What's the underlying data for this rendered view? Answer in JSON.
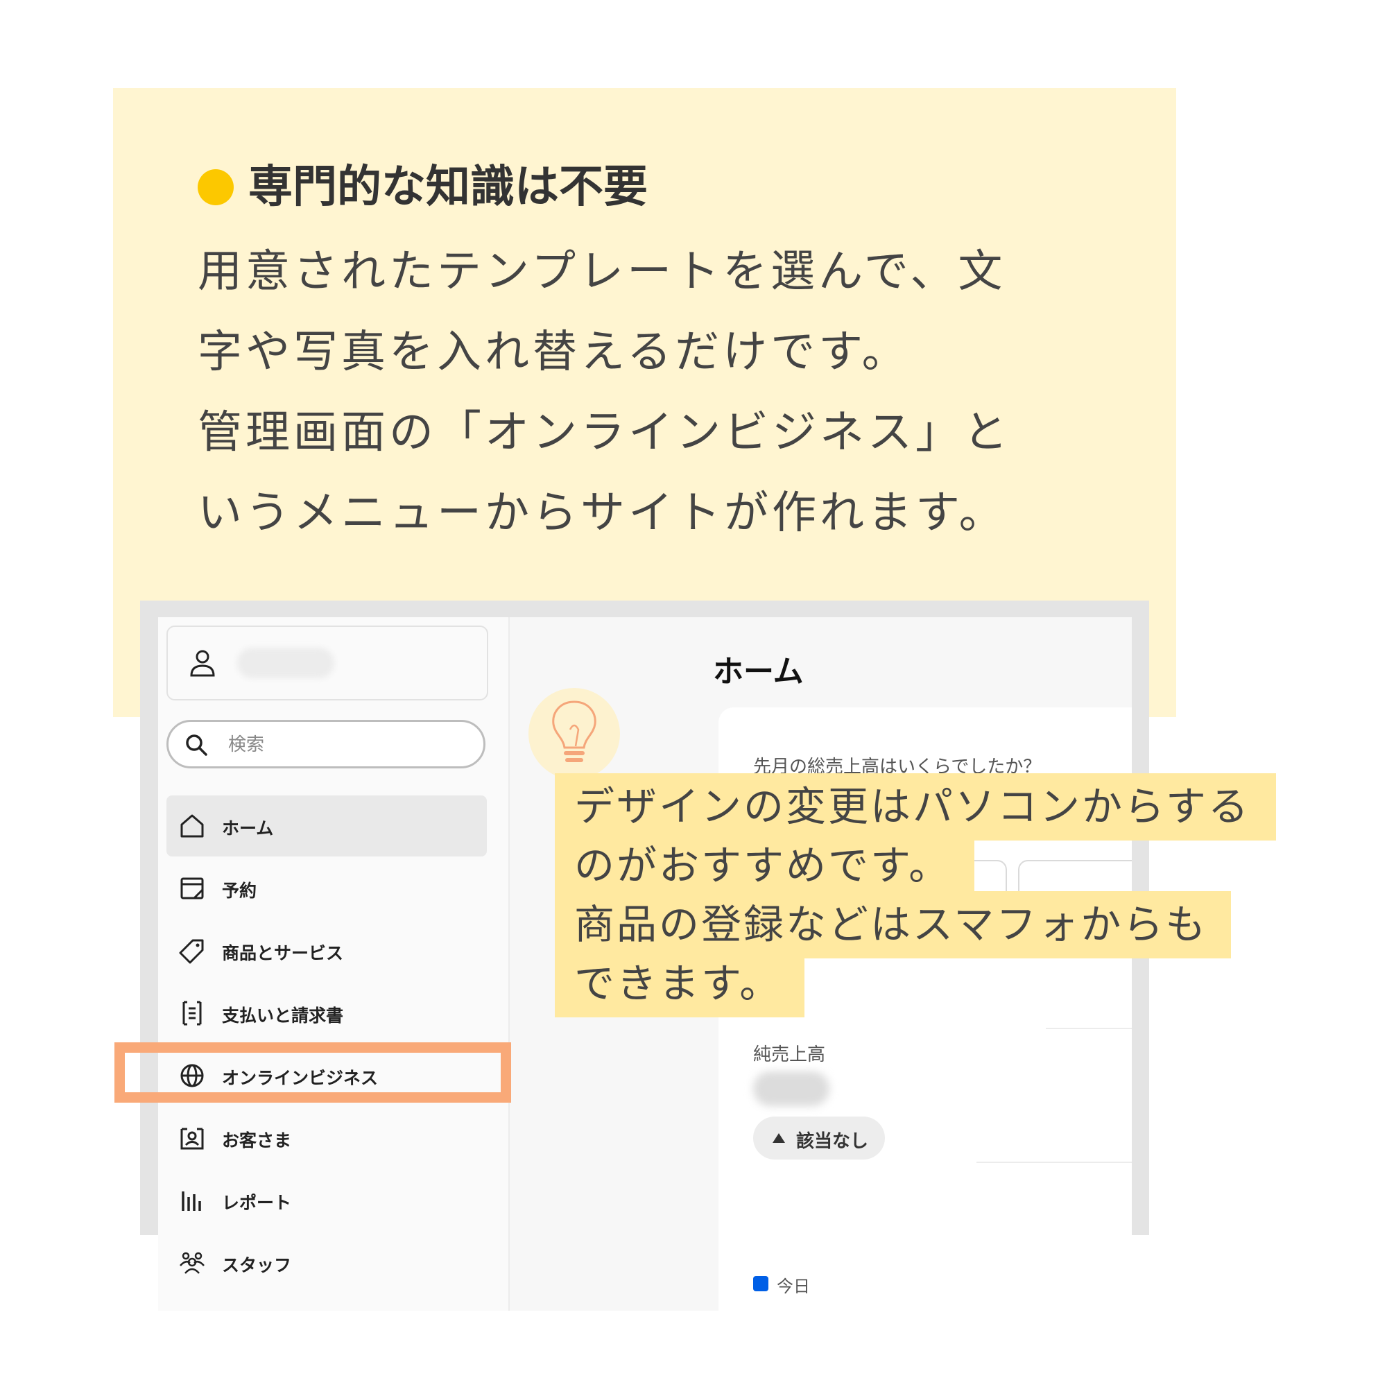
{
  "colors": {
    "panel_bg": "#fff5d1",
    "accent_dot": "#fcc800",
    "highlight_border": "#f9a978",
    "tip_bg": "#ffe9a0",
    "legend_blue": "#005fe6"
  },
  "headline": "専門的な知識は不要",
  "body_lines": [
    "用意されたテンプレートを選んで、文",
    "字や写真を入れ替えるだけです。",
    "管理画面の「オンラインビジネス」と",
    "いうメニューからサイトが作れます。"
  ],
  "screenshot": {
    "search_placeholder": "検索",
    "nav": [
      {
        "label": "ホーム",
        "icon": "home-icon"
      },
      {
        "label": "予約",
        "icon": "calendar-icon"
      },
      {
        "label": "商品とサービス",
        "icon": "tag-icon"
      },
      {
        "label": "支払いと請求書",
        "icon": "receipt-icon"
      },
      {
        "label": "オンラインビジネス",
        "icon": "globe-icon"
      },
      {
        "label": "お客さま",
        "icon": "contact-card-icon"
      },
      {
        "label": "レポート",
        "icon": "bar-chart-icon"
      },
      {
        "label": "スタッフ",
        "icon": "people-icon"
      }
    ],
    "main_title": "ホーム",
    "question": "先月の総売上高はいくらでしたか？",
    "net_sales_label": "純売上高",
    "badge_label": "該当なし",
    "legend_today": "今日"
  },
  "tip_lines": [
    "デザインの変更はパソコンからする",
    "のがおすすめです。",
    "商品の登録などはスマフォからも",
    "できます。"
  ]
}
